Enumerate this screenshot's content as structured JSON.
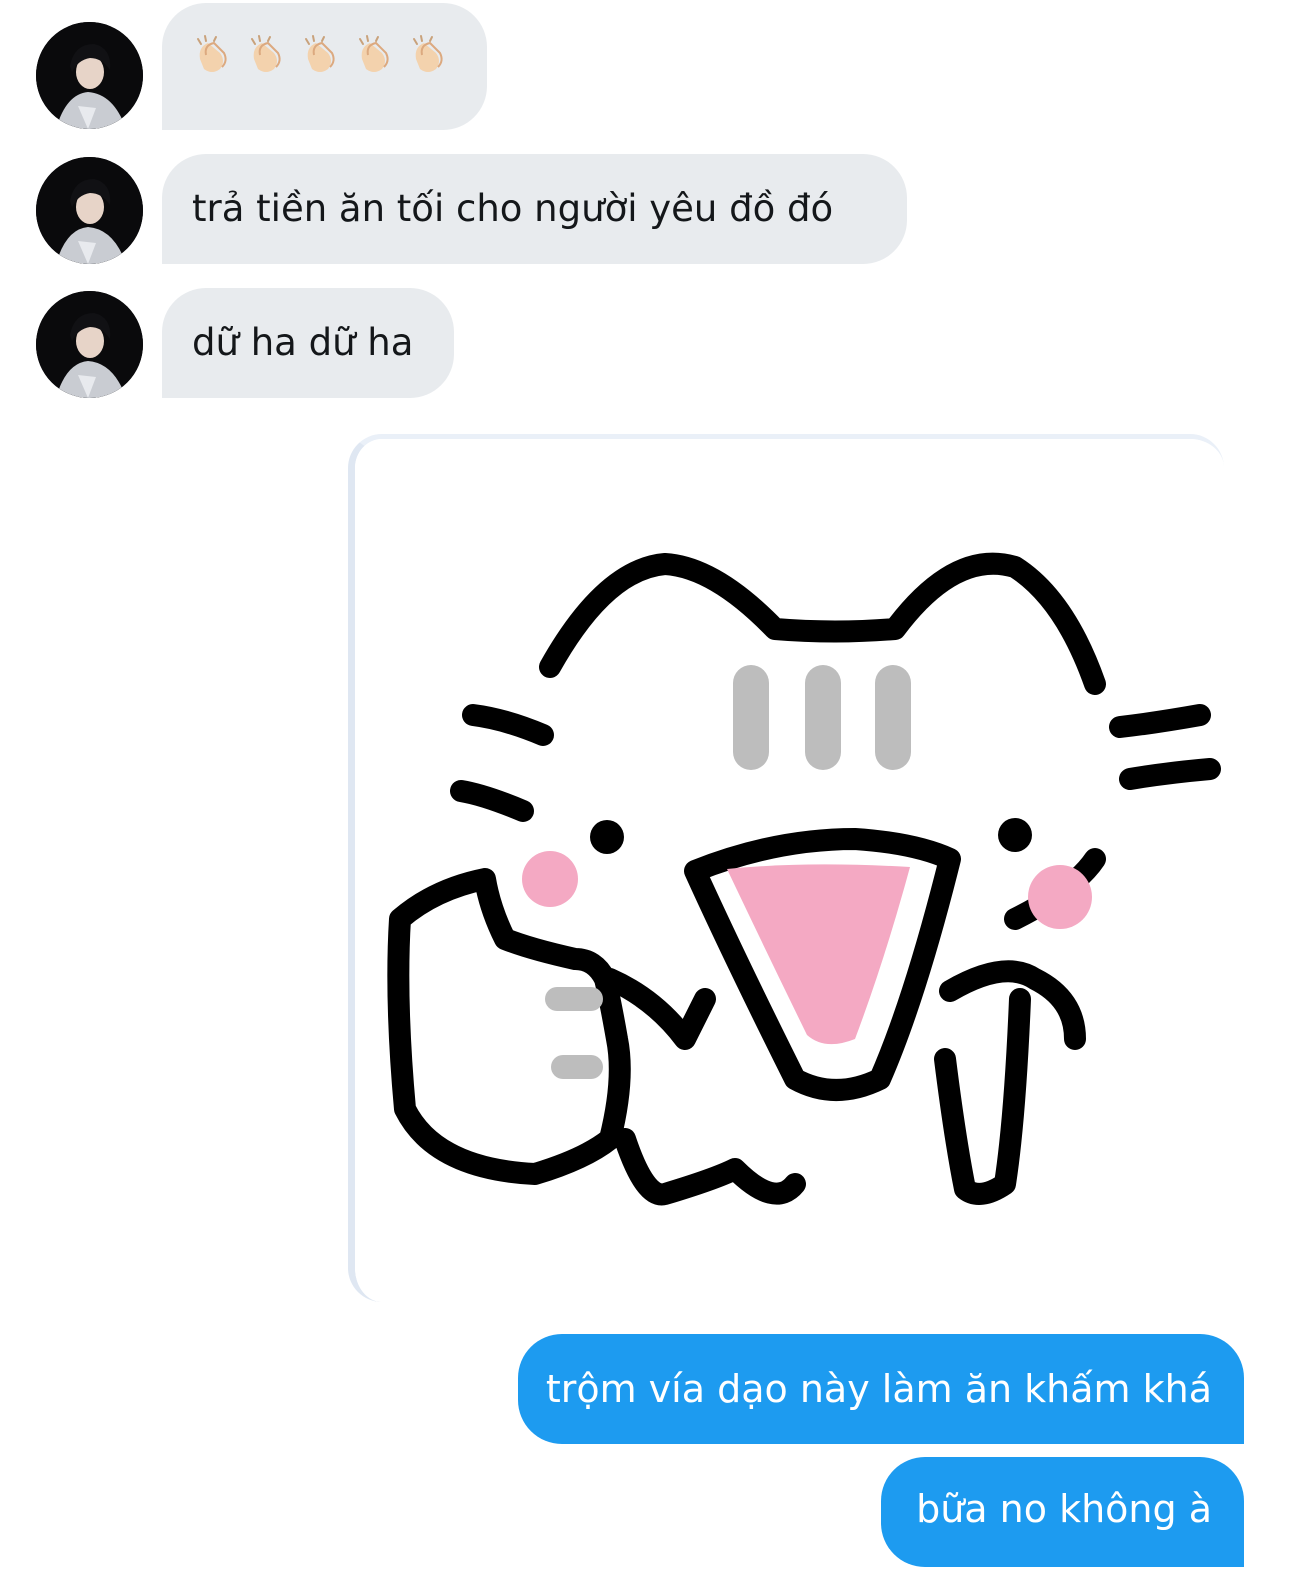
{
  "conversation": {
    "incoming": [
      {
        "type": "emoji",
        "emoji": [
          "clapping-hands",
          "clapping-hands",
          "clapping-hands",
          "clapping-hands",
          "clapping-hands"
        ]
      },
      {
        "type": "text",
        "text": "trả tiền ăn tối cho người yêu đồ đó"
      },
      {
        "type": "text",
        "text": "dữ ha dữ ha"
      }
    ],
    "sticker": {
      "type": "sticker",
      "icon": "cat-thumbs-up-sticker"
    },
    "outgoing": [
      {
        "type": "text",
        "text": "trộm vía dạo này làm ăn khấm khá"
      },
      {
        "type": "text",
        "text": "bữa no không à"
      }
    ]
  },
  "colors": {
    "incoming_bubble": "#e8ebee",
    "outgoing_bubble": "#1d9bf0",
    "incoming_text": "#14171a",
    "outgoing_text": "#ffffff"
  }
}
